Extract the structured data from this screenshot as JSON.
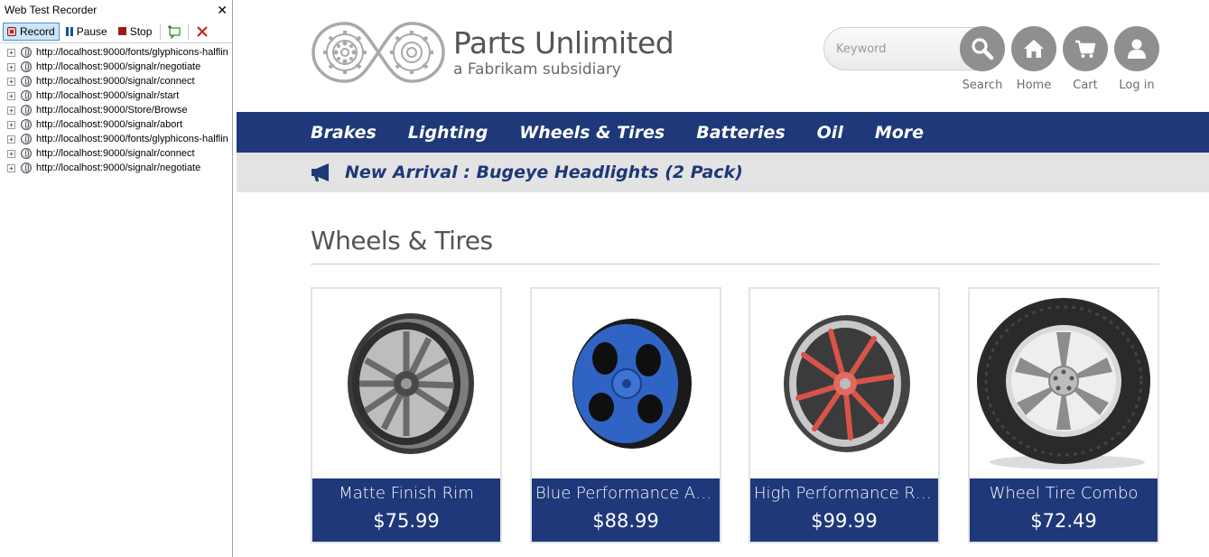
{
  "recorder": {
    "title": "Web Test Recorder",
    "close": "✕",
    "toolbar": {
      "record": "Record",
      "pause": "Pause",
      "stop": "Stop"
    },
    "requests": [
      "http://localhost:9000/fonts/glyphicons-halflin",
      "http://localhost:9000/signalr/negotiate",
      "http://localhost:9000/signalr/connect",
      "http://localhost:9000/signalr/start",
      "http://localhost:9000/Store/Browse",
      "http://localhost:9000/signalr/abort",
      "http://localhost:9000/fonts/glyphicons-halflin",
      "http://localhost:9000/signalr/connect",
      "http://localhost:9000/signalr/negotiate"
    ]
  },
  "site": {
    "brand": "Parts Unlimited",
    "tagline": "a Fabrikam subsidiary",
    "search": {
      "placeholder": "Keyword",
      "label": "Search"
    },
    "nav": {
      "home": "Home",
      "cart": "Cart",
      "login": "Log in"
    },
    "menu": [
      "Brakes",
      "Lighting",
      "Wheels & Tires",
      "Batteries",
      "Oil",
      "More"
    ],
    "announcement": "New Arrival : Bugeye Headlights (2 Pack)",
    "category": "Wheels & Tires",
    "products": [
      {
        "name": "Matte Finish Rim",
        "price": "$75.99",
        "accent": "#6b6b6b"
      },
      {
        "name": "Blue Performance All...",
        "price": "$88.99",
        "accent": "#2f64c4"
      },
      {
        "name": "High Performance Rim",
        "price": "$99.99",
        "accent": "#d9534a"
      },
      {
        "name": "Wheel Tire Combo",
        "price": "$72.49",
        "accent": "#c9c9c9"
      }
    ]
  },
  "colors": {
    "navy": "#1e3879",
    "gray_button": "#8f8f8f",
    "panel_border": "#a0a0a0"
  }
}
